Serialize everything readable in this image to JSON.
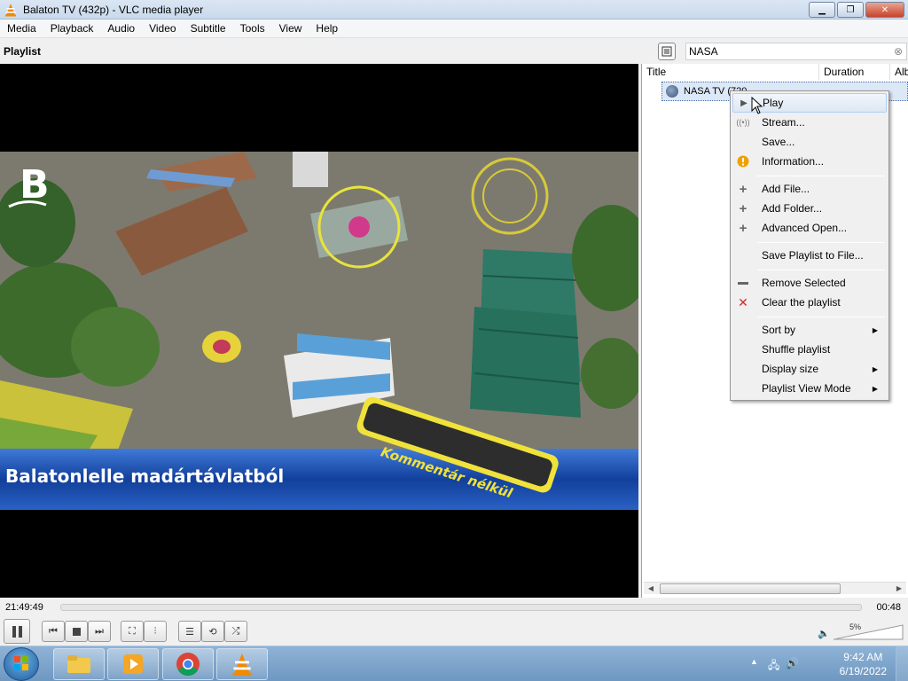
{
  "window": {
    "title": "Balaton TV (432p) - VLC media player",
    "minimize_icon": "minimize-icon",
    "maximize_icon": "restore-icon",
    "close_icon": "close-icon"
  },
  "menubar": [
    "Media",
    "Playback",
    "Audio",
    "Video",
    "Subtitle",
    "Tools",
    "View",
    "Help"
  ],
  "playlist_header": {
    "title": "Playlist",
    "search_value": "NASA",
    "search_clear": "⊗"
  },
  "video": {
    "overlay_text": "Balatonlelle madártávlatból",
    "badge_text": "Kommentár nélkül"
  },
  "playlist": {
    "columns": [
      "Title",
      "Duration",
      "Alb"
    ],
    "rows": [
      {
        "title": "NASA TV (720..."
      }
    ]
  },
  "context_menu": {
    "items": [
      {
        "label": "Play",
        "icon": "play-icon",
        "hover": true
      },
      {
        "label": "Stream...",
        "icon": "stream-icon"
      },
      {
        "label": "Save...",
        "icon": ""
      },
      {
        "label": "Information...",
        "icon": "info-icon"
      },
      {
        "label": "Add File...",
        "icon": "plus-icon"
      },
      {
        "label": "Add Folder...",
        "icon": "plus-icon"
      },
      {
        "label": "Advanced Open...",
        "icon": "plus-icon"
      },
      {
        "label": "Save Playlist to File...",
        "icon": ""
      },
      {
        "label": "Remove Selected",
        "icon": "minus-icon"
      },
      {
        "label": "Clear the playlist",
        "icon": "delete-icon"
      },
      {
        "label": "Sort by",
        "icon": "",
        "submenu": true
      },
      {
        "label": "Shuffle playlist",
        "icon": ""
      },
      {
        "label": "Display size",
        "icon": "",
        "submenu": true
      },
      {
        "label": "Playlist View Mode",
        "icon": "",
        "submenu": true
      }
    ]
  },
  "seek": {
    "elapsed": "21:49:49",
    "remaining": "00:48",
    "progress": 0
  },
  "volume": {
    "percent_label": "5%",
    "level": 0.05
  },
  "taskbar": {
    "clock_time": "9:42 AM",
    "clock_date": "6/19/2022"
  },
  "colors": {
    "accent": "#3399ff",
    "vlc_orange": "#f08a00",
    "video_band": "#1b4fae"
  }
}
